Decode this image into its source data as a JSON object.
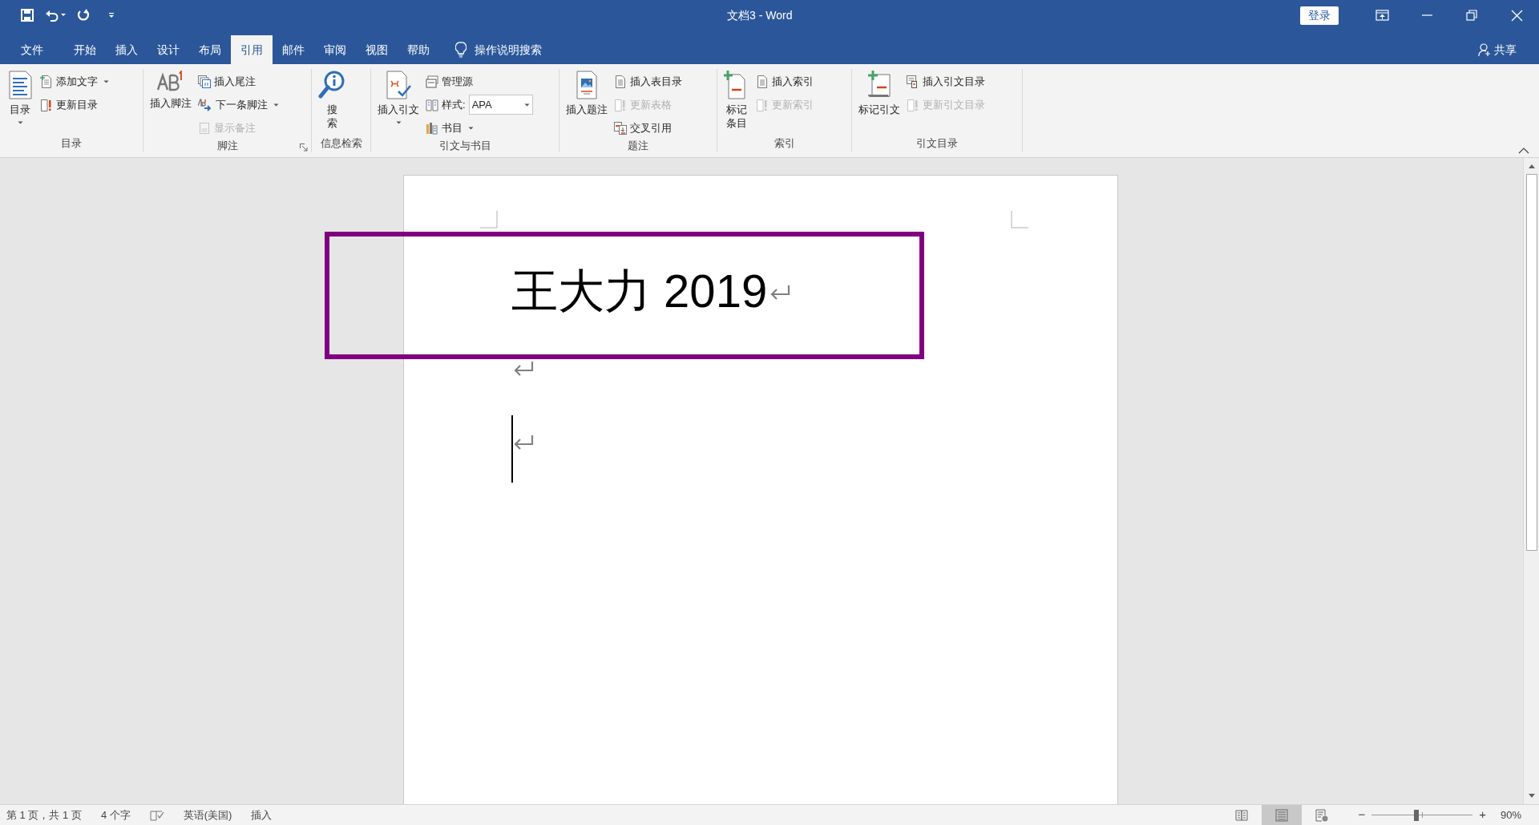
{
  "window": {
    "title": "文档3 - Word",
    "sign_in": "登录"
  },
  "tabs": [
    {
      "label": "文件",
      "selected": false
    },
    {
      "label": "开始",
      "selected": false
    },
    {
      "label": "插入",
      "selected": false
    },
    {
      "label": "设计",
      "selected": false
    },
    {
      "label": "布局",
      "selected": false
    },
    {
      "label": "引用",
      "selected": true
    },
    {
      "label": "邮件",
      "selected": false
    },
    {
      "label": "审阅",
      "selected": false
    },
    {
      "label": "视图",
      "selected": false
    },
    {
      "label": "帮助",
      "selected": false
    }
  ],
  "tell_me": "操作说明搜索",
  "share": "共享",
  "ribbon": {
    "groups": [
      {
        "label": "目录",
        "items": [
          {
            "kind": "large",
            "label": "目录",
            "dropdown": true,
            "disabled": false
          },
          {
            "kind": "small",
            "label": "添加文字",
            "dropdown": true,
            "disabled": false
          },
          {
            "kind": "small",
            "label": "更新目录",
            "dropdown": false,
            "disabled": false
          }
        ]
      },
      {
        "label": "脚注",
        "launcher": true,
        "items": [
          {
            "kind": "large",
            "label": "插入脚注",
            "dropdown": false,
            "disabled": false
          },
          {
            "kind": "small",
            "label": "插入尾注",
            "dropdown": false,
            "disabled": false
          },
          {
            "kind": "small",
            "label": "下一条脚注",
            "dropdown": true,
            "disabled": false
          },
          {
            "kind": "small",
            "label": "显示备注",
            "dropdown": false,
            "disabled": true
          }
        ]
      },
      {
        "label": "信息检索",
        "items": [
          {
            "kind": "large",
            "label": "搜索",
            "dropdown": false,
            "disabled": false
          }
        ]
      },
      {
        "label": "引文与书目",
        "items": [
          {
            "kind": "large",
            "label": "插入引文",
            "dropdown": true,
            "disabled": false
          },
          {
            "kind": "small",
            "label": "管理源",
            "dropdown": false,
            "disabled": false
          },
          {
            "kind": "combo",
            "label": "样式:",
            "value": "APA"
          },
          {
            "kind": "small",
            "label": "书目",
            "dropdown": true,
            "disabled": false
          }
        ]
      },
      {
        "label": "题注",
        "items": [
          {
            "kind": "large",
            "label": "插入题注",
            "dropdown": false,
            "disabled": false
          },
          {
            "kind": "small",
            "label": "插入表目录",
            "dropdown": false,
            "disabled": false
          },
          {
            "kind": "small",
            "label": "更新表格",
            "dropdown": false,
            "disabled": true
          },
          {
            "kind": "small",
            "label": "交叉引用",
            "dropdown": false,
            "disabled": false
          }
        ]
      },
      {
        "label": "索引",
        "items": [
          {
            "kind": "large",
            "label": "标记条目",
            "dropdown": false,
            "disabled": false
          },
          {
            "kind": "small",
            "label": "插入索引",
            "dropdown": false,
            "disabled": false
          },
          {
            "kind": "small",
            "label": "更新索引",
            "dropdown": false,
            "disabled": true
          }
        ]
      },
      {
        "label": "引文目录",
        "items": [
          {
            "kind": "large",
            "label": "标记引文",
            "dropdown": false,
            "disabled": false
          },
          {
            "kind": "small",
            "label": "插入引文目录",
            "dropdown": false,
            "disabled": false
          },
          {
            "kind": "small",
            "label": "更新引文目录",
            "dropdown": false,
            "disabled": true
          }
        ]
      }
    ]
  },
  "document": {
    "text": "王大力 2019"
  },
  "status_bar": {
    "page": "第 1 页，共 1 页",
    "words": "4 个字",
    "language": "英语(美国)",
    "mode": "插入",
    "views": [
      {
        "selected": false
      },
      {
        "selected": true
      },
      {
        "selected": false
      }
    ],
    "zoom": {
      "minus": "−",
      "plus": "+",
      "level": 0.44,
      "reading": "90%"
    }
  }
}
